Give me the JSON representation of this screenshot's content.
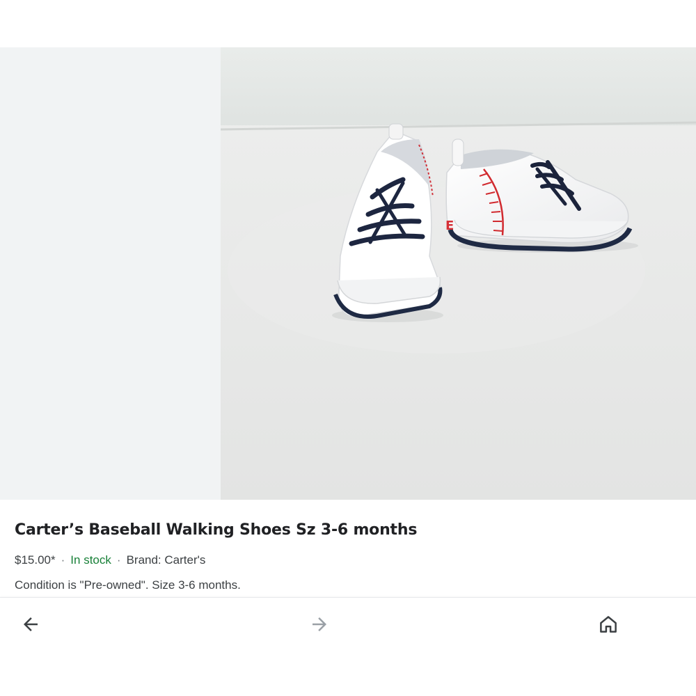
{
  "product": {
    "title": "Carter’s Baseball Walking Shoes Sz 3-6 months",
    "price": "$15.00*",
    "availability": "In stock",
    "brand": "Brand: Carter's",
    "description": "Condition is \"Pre-owned\". Size 3-6 months.",
    "separator": "·"
  },
  "nav": {
    "back_icon": "arrow-left-icon",
    "forward_icon": "arrow-right-icon",
    "home_icon": "home-icon"
  },
  "colors": {
    "in_stock": "#188038",
    "title_text": "#202124",
    "body_text": "#3c4043",
    "placeholder_bg": "#f1f3f4"
  }
}
